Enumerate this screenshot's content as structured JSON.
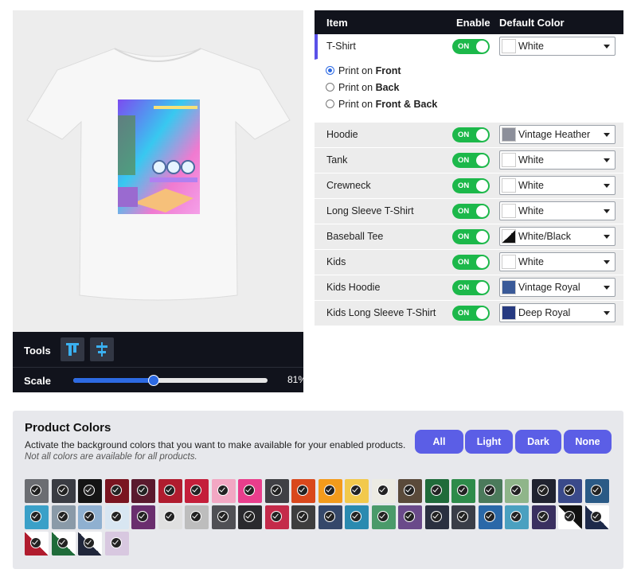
{
  "tools": {
    "label": "Tools",
    "scale_label": "Scale",
    "scale_value": "81%",
    "scale_fraction": 0.41
  },
  "table": {
    "headers": {
      "item": "Item",
      "enable": "Enable",
      "default_color": "Default Color"
    },
    "first": {
      "name": "T-Shirt",
      "toggle": "ON",
      "color": "White",
      "swatch": "#ffffff"
    },
    "print_options": [
      {
        "prefix": "Print on ",
        "bold": "Front",
        "checked": true
      },
      {
        "prefix": "Print on ",
        "bold": "Back",
        "checked": false
      },
      {
        "prefix": "Print on ",
        "bold": "Front & Back",
        "checked": false
      }
    ],
    "rows": [
      {
        "name": "Hoodie",
        "toggle": "ON",
        "color": "Vintage Heather",
        "swatch": "#8c8f9a"
      },
      {
        "name": "Tank",
        "toggle": "ON",
        "color": "White",
        "swatch": "#ffffff"
      },
      {
        "name": "Crewneck",
        "toggle": "ON",
        "color": "White",
        "swatch": "#ffffff"
      },
      {
        "name": "Long Sleeve T-Shirt",
        "toggle": "ON",
        "color": "White",
        "swatch": "#ffffff"
      },
      {
        "name": "Baseball Tee",
        "toggle": "ON",
        "color": "White/Black",
        "swatch": "split-white-black"
      },
      {
        "name": "Kids",
        "toggle": "ON",
        "color": "White",
        "swatch": "#ffffff"
      },
      {
        "name": "Kids Hoodie",
        "toggle": "ON",
        "color": "Vintage Royal",
        "swatch": "#3a5a98"
      },
      {
        "name": "Kids Long Sleeve T-Shirt",
        "toggle": "ON",
        "color": "Deep Royal",
        "swatch": "#263a80"
      }
    ]
  },
  "product_colors": {
    "title": "Product Colors",
    "subtitle": "Activate the background colors that you want to make available for your enabled products.",
    "note": "Not all colors are available for all products.",
    "buttons": [
      "All",
      "Light",
      "Dark",
      "None"
    ],
    "swatches": [
      "#6b6d72",
      "#3a3c43",
      "#141414",
      "#7a1420",
      "#5a1a2e",
      "#b01c2e",
      "#c41e3a",
      "#f2a7c3",
      "#e83e8c",
      "#404045",
      "#d9481c",
      "#f39b1b",
      "#f2c94c",
      "#ecebe3",
      "#5a4a3a",
      "#1f6b3a",
      "#2e8b4a",
      "#4b7a5b",
      "#8fb58a",
      "#202330",
      "#3a4a8a",
      "#2a5a86",
      "#3aa0c8",
      "#8a9aa8",
      "#8fb0d0",
      "#d8e6f2",
      "#6a2e6e",
      "#e0e0e0",
      "#bdbdbd",
      "#505055",
      "#2a2a2e",
      "#c42a4a",
      "#3e3e3e",
      "#35486a",
      "#2a8ab0",
      "#4a9a6a",
      "#6a4a8a",
      "#2a3040",
      "#3a3e48",
      "#2a68a8",
      "#4aa0c0",
      "#3a3060",
      "split-black-white",
      "split-navy-white",
      "split-red-white",
      "split-green-white",
      "split-navy-white2",
      "#d8c8e0"
    ]
  }
}
